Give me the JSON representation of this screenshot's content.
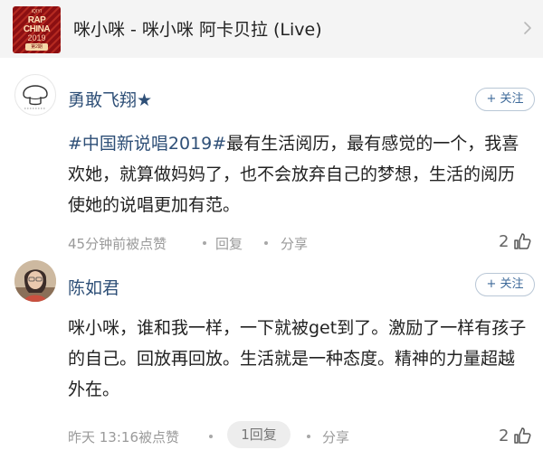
{
  "song": {
    "title": "咪小咪 - 咪小咪 阿卡贝拉 (Live)",
    "album_art": {
      "top_text": "iQIYI",
      "logo_text": "RAP CHINA",
      "year": "2019",
      "episode": "第2期"
    }
  },
  "comments": [
    {
      "username": "勇敢飞翔★",
      "follow_label": "+ 关注",
      "topic": "#中国新说唱2019#",
      "text": "最有生活阅历，最有感觉的一个，我喜欢她，就算做妈妈了，也不会放弃自己的梦想，生活的阅历使她的说唱更加有范。",
      "time": "45分钟前被点赞",
      "reply_label": "回复",
      "share_label": "分享",
      "likes": "2"
    },
    {
      "username": "陈如君",
      "follow_label": "+ 关注",
      "text": "咪小咪，谁和我一样，一下就被get到了。激励了一样有孩子的自己。回放再回放。生活就是一种态度。精神的力量超越外在。",
      "time": "昨天 13:16被点赞",
      "reply_label": "1回复",
      "share_label": "分享",
      "likes": "2"
    }
  ],
  "icons": {
    "chevron": "chevron-right-icon",
    "like": "thumbs-up-icon"
  },
  "colors": {
    "username": "#2e4f77",
    "follow": "#3e6a9a",
    "meta": "#9a9a9a",
    "header_bg": "#f4f4f4"
  }
}
